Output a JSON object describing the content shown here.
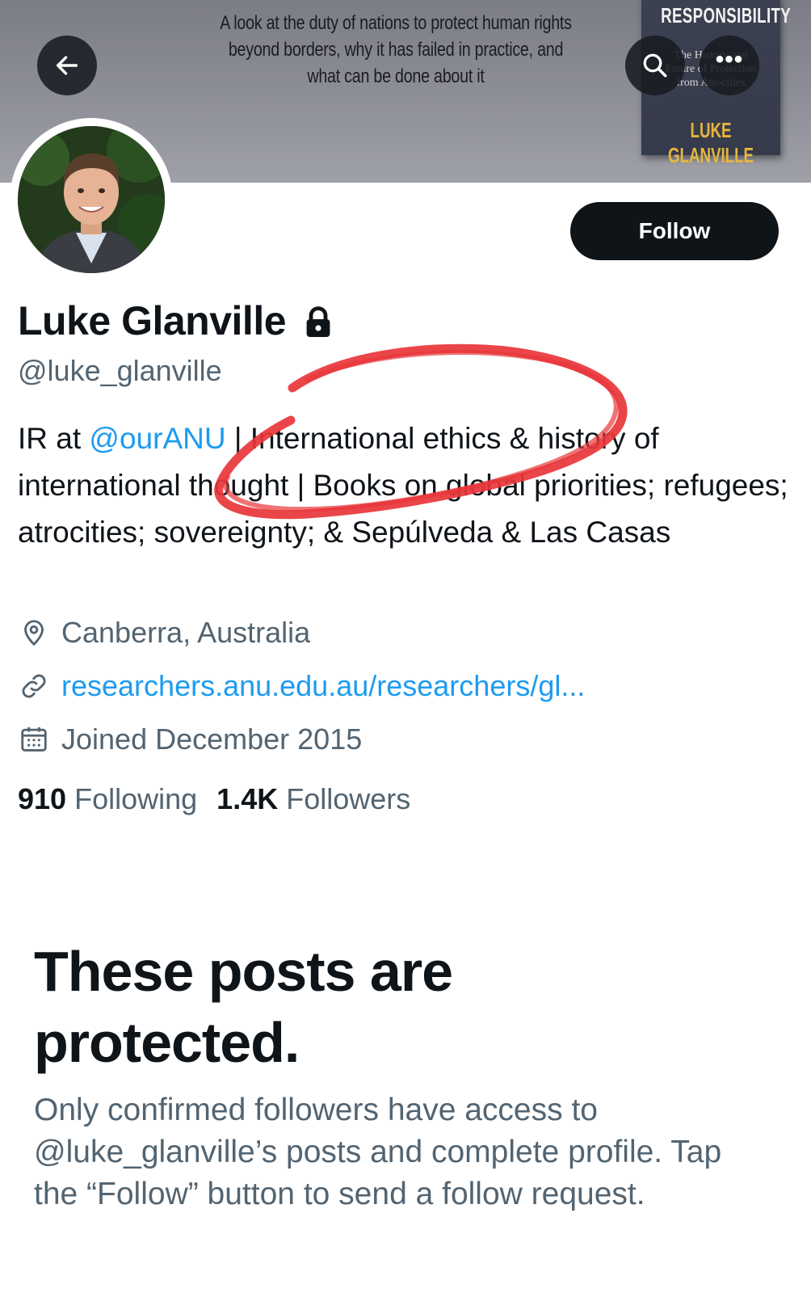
{
  "banner": {
    "tagline": "A look at the duty of nations to protect human rights beyond borders, why it has failed in practice, and what can be done about it",
    "book_title": "RESPONSIBILITY",
    "book_subtitle_line1": "The History and",
    "book_subtitle_line2": "Future of Protection",
    "book_subtitle_line3": "from Atrocities",
    "book_author": "LUKE GLANVILLE"
  },
  "header": {
    "back_icon": "arrow-left-icon",
    "search_icon": "search-icon",
    "more_icon": "more-icon",
    "more_label": "•••"
  },
  "profile": {
    "avatar_icon": "avatar",
    "follow_label": "Follow",
    "display_name": "Luke Glanville",
    "handle": "@luke_glanville",
    "bio_prefix": "IR at ",
    "bio_mention": "@ourANU",
    "bio_rest": " | International ethics & history of international thought | Books on global priorities; refugees; atrocities; sovereignty; & Sepúlveda & Las Casas",
    "location": "Canberra, Australia",
    "link": "researchers.anu.edu.au/researchers/gl...",
    "joined": "Joined December 2015",
    "following_count": "910",
    "following_label": "Following",
    "followers_count": "1.4K",
    "followers_label": "Followers"
  },
  "protected": {
    "title": "These posts are protected.",
    "description": "Only confirmed followers have access to @luke_glanville’s posts and complete profile. Tap the “Follow” button to send a follow request."
  },
  "colors": {
    "accent": "#1d9bf0",
    "text": "#0f1419",
    "secondary": "#536471",
    "annotation": "#e8363b"
  }
}
